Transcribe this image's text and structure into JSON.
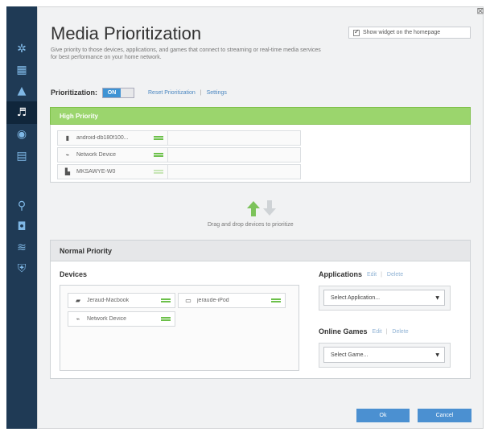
{
  "sidebar": {
    "icons": [
      "network-icon",
      "router-icon",
      "alert-icon",
      "media-priority-icon",
      "connectivity-icon",
      "map-icon",
      "parental-icon",
      "camera-icon",
      "wireless-icon",
      "security-icon"
    ],
    "active": "media-priority-icon"
  },
  "header": {
    "title": "Media Prioritization",
    "description": "Give priority to those devices, applications, and games that connect to streaming or real-time media services for best performance on your home network.",
    "widget_label": "Show widget on the homepage",
    "widget_checked": true
  },
  "prioritization": {
    "label": "Prioritization:",
    "toggle_state": "ON",
    "reset_label": "Reset Prioritization",
    "separator": "|",
    "settings_label": "Settings"
  },
  "high_priority": {
    "title": "High Priority",
    "devices": [
      {
        "icon": "phone-icon",
        "name": "android-db180f100...",
        "signal": "strong"
      },
      {
        "icon": "network-device-icon",
        "name": "Network Device",
        "signal": "strong"
      },
      {
        "icon": "computer-icon",
        "name": "MKSAWYE-W0",
        "signal": "faint"
      }
    ]
  },
  "drag_hint": "Drag and drop devices to prioritize",
  "normal_priority": {
    "title": "Normal Priority",
    "devices_label": "Devices",
    "devices": [
      {
        "icon": "laptop-icon",
        "name": "Jeraud-Macbook"
      },
      {
        "icon": "ipod-icon",
        "name": "jeraude-iPod"
      },
      {
        "icon": "network-device-icon",
        "name": "Network Device"
      }
    ],
    "applications": {
      "label": "Applications",
      "edit_label": "Edit",
      "separator": "|",
      "delete_label": "Delete",
      "placeholder": "Select Application..."
    },
    "online_games": {
      "label": "Online Games",
      "edit_label": "Edit",
      "separator": "|",
      "delete_label": "Delete",
      "placeholder": "Select Game..."
    }
  },
  "footer": {
    "ok_label": "Ok",
    "cancel_label": "Cancel"
  },
  "colors": {
    "sidebar": "#1f3a55",
    "high_priority_header": "#9bd56d",
    "accent": "#4b90d1"
  }
}
